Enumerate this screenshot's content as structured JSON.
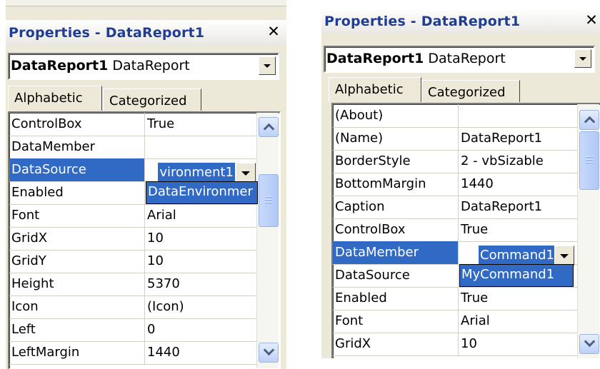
{
  "left": {
    "title": "Properties - DataReport1",
    "close": "✕",
    "object_name": "DataReport1",
    "object_type": "DataReport",
    "tabs": [
      "Alphabetic",
      "Categorized"
    ],
    "rows": [
      {
        "name": "ControlBox",
        "value": "True"
      },
      {
        "name": "DataMember",
        "value": ""
      },
      {
        "name": "DataSource",
        "value": "vironment1"
      },
      {
        "name": "Enabled",
        "value": ""
      },
      {
        "name": "Font",
        "value": "Arial"
      },
      {
        "name": "GridX",
        "value": "10"
      },
      {
        "name": "GridY",
        "value": "10"
      },
      {
        "name": "Height",
        "value": "5370"
      },
      {
        "name": "Icon",
        "value": "(Icon)"
      },
      {
        "name": "Left",
        "value": "0"
      },
      {
        "name": "LeftMargin",
        "value": "1440"
      }
    ],
    "selected_row": "DataSource",
    "dropdown_item": "DataEnvironmer"
  },
  "right": {
    "title": "Properties - DataReport1",
    "close": "✕",
    "object_name": "DataReport1",
    "object_type": "DataReport",
    "tabs": [
      "Alphabetic",
      "Categorized"
    ],
    "rows": [
      {
        "name": "(About)",
        "value": ""
      },
      {
        "name": "(Name)",
        "value": "DataReport1"
      },
      {
        "name": "BorderStyle",
        "value": "2 - vbSizable"
      },
      {
        "name": "BottomMargin",
        "value": "1440"
      },
      {
        "name": "Caption",
        "value": "DataReport1"
      },
      {
        "name": "ControlBox",
        "value": "True"
      },
      {
        "name": "DataMember",
        "value": "Command1"
      },
      {
        "name": "DataSource",
        "value": ""
      },
      {
        "name": "Enabled",
        "value": "True"
      },
      {
        "name": "Font",
        "value": "Arial"
      },
      {
        "name": "GridX",
        "value": "10"
      }
    ],
    "selected_row": "DataMember",
    "dropdown_item": "MyCommand1"
  },
  "colors": {
    "title": "#1f3d93",
    "selection": "#316ac5",
    "panel": "#ece9d8"
  },
  "icons": [
    "close-icon",
    "chevron-down-icon",
    "chevron-up-icon",
    "scroll-thumb-grip"
  ]
}
